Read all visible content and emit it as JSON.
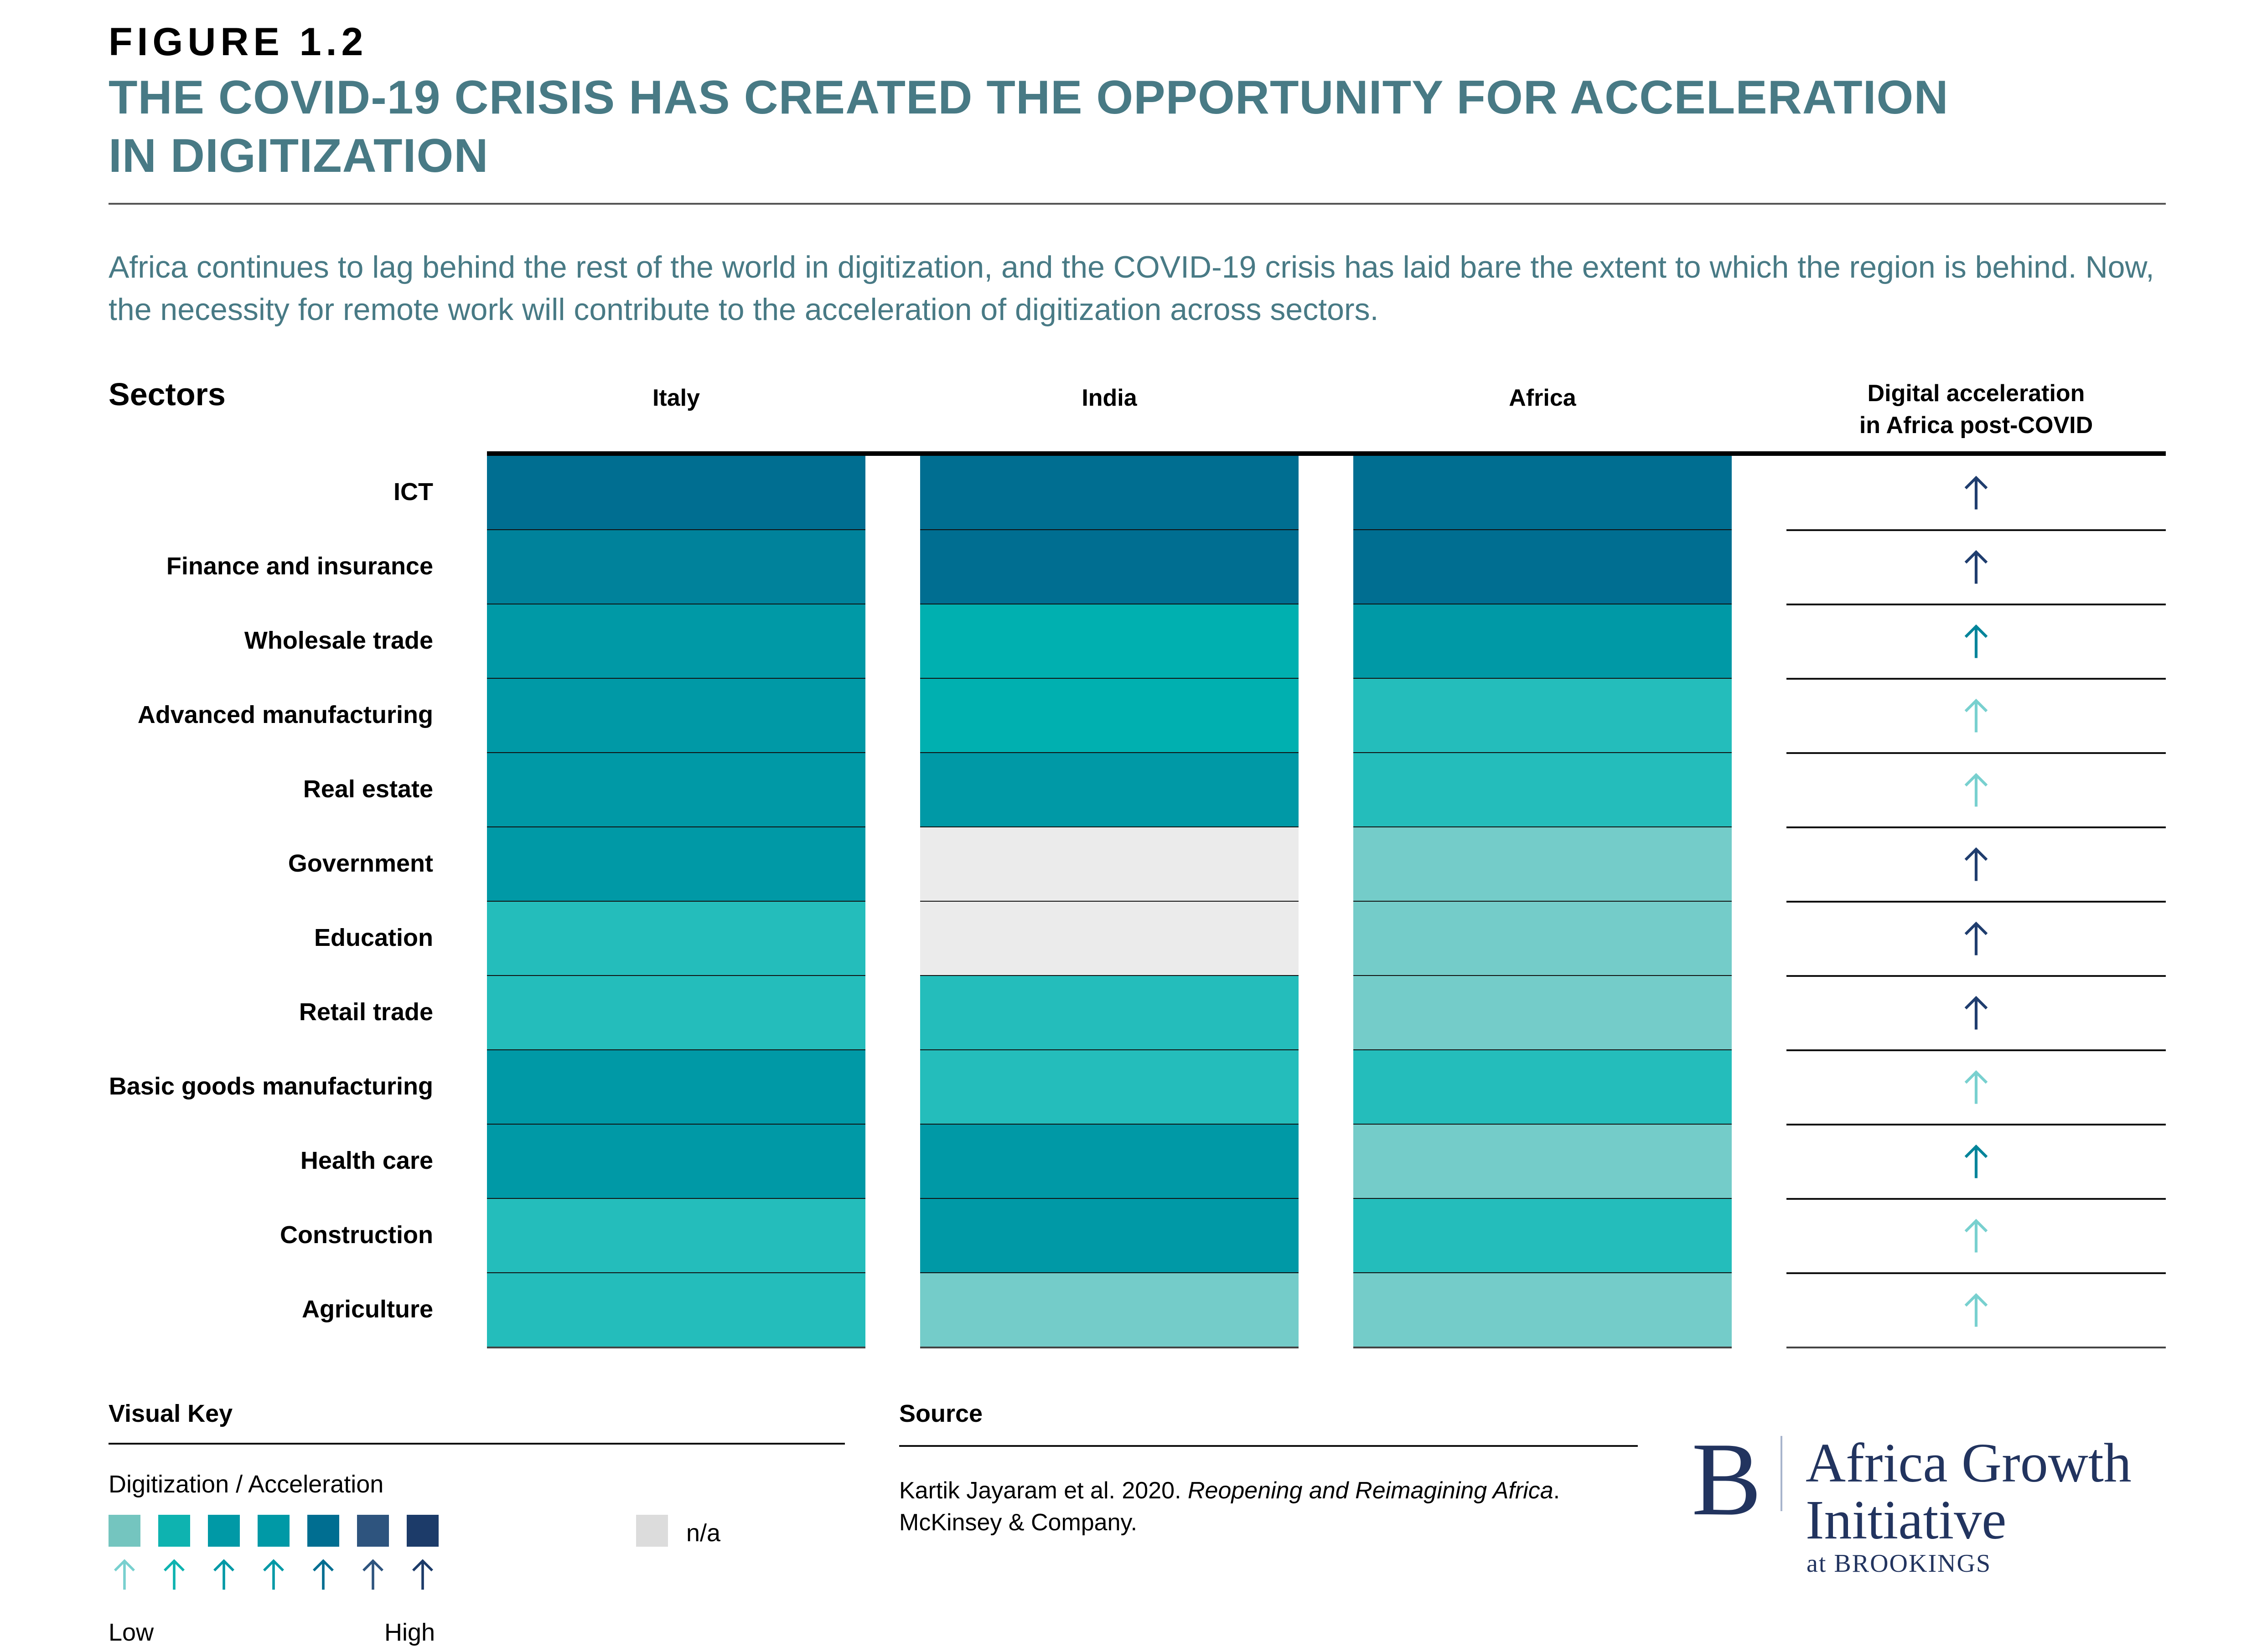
{
  "figure_label": "FIGURE 1.2",
  "title_line1": "THE COVID-19 CRISIS HAS CREATED THE OPPORTUNITY FOR ACCELERATION",
  "title_line2": "IN DIGITIZATION",
  "subtitle": "Africa continues to lag behind the rest of the world in digitization, and the COVID-19 crisis has laid bare the extent to which the region is behind. Now, the necessity for remote work will contribute to the acceleration of digitization across sectors.",
  "colors": {
    "title": "#487A85",
    "scale": [
      "#74C5BF",
      "#0EB3B0",
      "#0099A6",
      "#0099A6",
      "#006E91",
      "#2E547E",
      "#1C3B69"
    ],
    "na": "#DCDCDC",
    "cell_na": "#EBEBEB",
    "logo": "#22345F"
  },
  "chart_data": {
    "type": "heatmap",
    "title": "THE COVID-19 CRISIS HAS CREATED THE OPPORTUNITY FOR ACCELERATION IN DIGITIZATION",
    "row_header": "Sectors",
    "columns": [
      "Italy",
      "India",
      "Africa"
    ],
    "acceleration_header_line1": "Digital acceleration",
    "acceleration_header_line2": "in Africa post-COVID",
    "scale_description": "Digitization / Acceleration, levels 1 (Low) to 7 (High); n/a = not available",
    "rows": [
      {
        "sector": "ICT",
        "cells": [
          {
            "level": 5,
            "color": "#006E91"
          },
          {
            "level": 5,
            "color": "#006E91"
          },
          {
            "level": 5,
            "color": "#006E91"
          }
        ],
        "acceleration": {
          "level": 7,
          "color": "#1F3D6E"
        }
      },
      {
        "sector": "Finance and insurance",
        "cells": [
          {
            "level": 4,
            "color": "#00829B"
          },
          {
            "level": 5,
            "color": "#006E91"
          },
          {
            "level": 5,
            "color": "#006E91"
          }
        ],
        "acceleration": {
          "level": 7,
          "color": "#1F3D6E"
        }
      },
      {
        "sector": "Wholesale trade",
        "cells": [
          {
            "level": 3,
            "color": "#0099A6"
          },
          {
            "level": 2,
            "color": "#00B0B0"
          },
          {
            "level": 3,
            "color": "#0099A6"
          }
        ],
        "acceleration": {
          "level": 5,
          "color": "#00849A"
        }
      },
      {
        "sector": "Advanced manufacturing",
        "cells": [
          {
            "level": 3,
            "color": "#0099A6"
          },
          {
            "level": 2,
            "color": "#00B0B0"
          },
          {
            "level": 2,
            "color": "#24BDBB"
          }
        ],
        "acceleration": {
          "level": 1,
          "color": "#78D0CF"
        }
      },
      {
        "sector": "Real estate",
        "cells": [
          {
            "level": 3,
            "color": "#0099A6"
          },
          {
            "level": 3,
            "color": "#0099A6"
          },
          {
            "level": 2,
            "color": "#24BDBB"
          }
        ],
        "acceleration": {
          "level": 1,
          "color": "#78D0CF"
        }
      },
      {
        "sector": "Government",
        "cells": [
          {
            "level": 3,
            "color": "#0099A6"
          },
          {
            "level": null,
            "color": "#EBEBEB"
          },
          {
            "level": 1,
            "color": "#74CCC9"
          }
        ],
        "acceleration": {
          "level": 7,
          "color": "#1F3D6E"
        }
      },
      {
        "sector": "Education",
        "cells": [
          {
            "level": 2,
            "color": "#24BDBB"
          },
          {
            "level": null,
            "color": "#EBEBEB"
          },
          {
            "level": 1,
            "color": "#74CCC9"
          }
        ],
        "acceleration": {
          "level": 7,
          "color": "#1F3D6E"
        }
      },
      {
        "sector": "Retail trade",
        "cells": [
          {
            "level": 2,
            "color": "#24BDBB"
          },
          {
            "level": 2,
            "color": "#24BDBB"
          },
          {
            "level": 1,
            "color": "#74CCC9"
          }
        ],
        "acceleration": {
          "level": 7,
          "color": "#1F3D6E"
        }
      },
      {
        "sector": "Basic goods manufacturing",
        "cells": [
          {
            "level": 3,
            "color": "#0099A6"
          },
          {
            "level": 2,
            "color": "#24BDBB"
          },
          {
            "level": 2,
            "color": "#24BDBB"
          }
        ],
        "acceleration": {
          "level": 1,
          "color": "#78D0CF"
        }
      },
      {
        "sector": "Health care",
        "cells": [
          {
            "level": 3,
            "color": "#0099A6"
          },
          {
            "level": 3,
            "color": "#0099A6"
          },
          {
            "level": 1,
            "color": "#74CCC9"
          }
        ],
        "acceleration": {
          "level": 5,
          "color": "#00849A"
        }
      },
      {
        "sector": "Construction",
        "cells": [
          {
            "level": 2,
            "color": "#24BDBB"
          },
          {
            "level": 3,
            "color": "#0099A6"
          },
          {
            "level": 2,
            "color": "#24BDBB"
          }
        ],
        "acceleration": {
          "level": 1,
          "color": "#78D0CF"
        }
      },
      {
        "sector": "Agriculture",
        "cells": [
          {
            "level": 2,
            "color": "#24BDBB"
          },
          {
            "level": 1,
            "color": "#74CCC9"
          },
          {
            "level": 1,
            "color": "#74CCC9"
          }
        ],
        "acceleration": {
          "level": 1,
          "color": "#78D0CF"
        }
      }
    ],
    "legend": {
      "title": "Visual Key",
      "subtitle": "Digitization / Acceleration",
      "low_label": "Low",
      "high_label": "High",
      "na_label": "n/a",
      "levels": 7
    }
  },
  "source": {
    "title": "Source",
    "text_plain": "Kartik Jayaram et al. 2020. ",
    "text_italic": "Reopening and Reimagining Africa",
    "text_after": ".",
    "line2": "McKinsey & Company."
  },
  "logo": {
    "mark": "B",
    "line1": "Africa Growth",
    "line2": "Initiative",
    "line3": "at BROOKINGS"
  }
}
